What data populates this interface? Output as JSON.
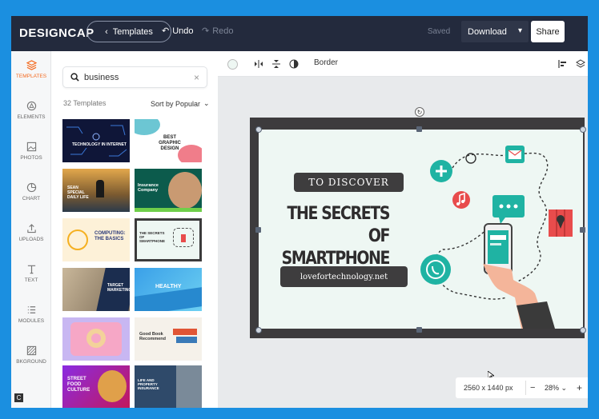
{
  "brand": {
    "logo": "DESIGNCAP",
    "accent": "#f46a1f",
    "topbar_bg": "#232a3d"
  },
  "header": {
    "back_label": "Templates",
    "undo_label": "Undo",
    "redo_label": "Redo",
    "saved_label": "Saved",
    "download_label": "Download",
    "share_label": "Share"
  },
  "rail": {
    "items": [
      {
        "label": "TEMPLATES",
        "icon": "layers-icon",
        "active": true
      },
      {
        "label": "ELEMENTS",
        "icon": "shapes-icon"
      },
      {
        "label": "PHOTOS",
        "icon": "image-icon"
      },
      {
        "label": "CHART",
        "icon": "pie-chart-icon"
      },
      {
        "label": "UPLOADS",
        "icon": "upload-icon"
      },
      {
        "label": "TEXT",
        "icon": "text-icon"
      },
      {
        "label": "MODULES",
        "icon": "list-icon"
      },
      {
        "label": "BKGROUND",
        "icon": "background-icon"
      }
    ]
  },
  "panel": {
    "search_value": "business",
    "count_label": "32 Templates",
    "sort_label": "Sort by Popular",
    "thumbnails": [
      {
        "title": "TECHNOLOGY IN INTERNET"
      },
      {
        "title": "BEST GRAPHIC DESIGN"
      },
      {
        "title": "SEAN SPECIAL DAILY LIFE"
      },
      {
        "title": "Insurance Company"
      },
      {
        "title": "COMPUTING: THE BASICS"
      },
      {
        "title": "THE SECRETS OF SMARTPHONE"
      },
      {
        "title": ""
      },
      {
        "title": "TARGET MARKETING"
      },
      {
        "title": ""
      },
      {
        "title": "HEALTHY"
      },
      {
        "title": ""
      },
      {
        "title": "Good Book Recommend"
      },
      {
        "title": "STREET FOOD CULTURE"
      },
      {
        "title": "LIFE AND PROPERTY INSURANCE"
      }
    ]
  },
  "toolbar": {
    "border_label": "Border"
  },
  "design": {
    "tag_top": "TO DISCOVER",
    "headline_line1": "THE SECRETS OF",
    "headline_line2": "SMARTPHONE",
    "tag_bottom": "lovefortechnology.net"
  },
  "status": {
    "dimensions": "2560 x 1440 px",
    "zoom": "28%",
    "minus": "−",
    "plus": "+"
  }
}
